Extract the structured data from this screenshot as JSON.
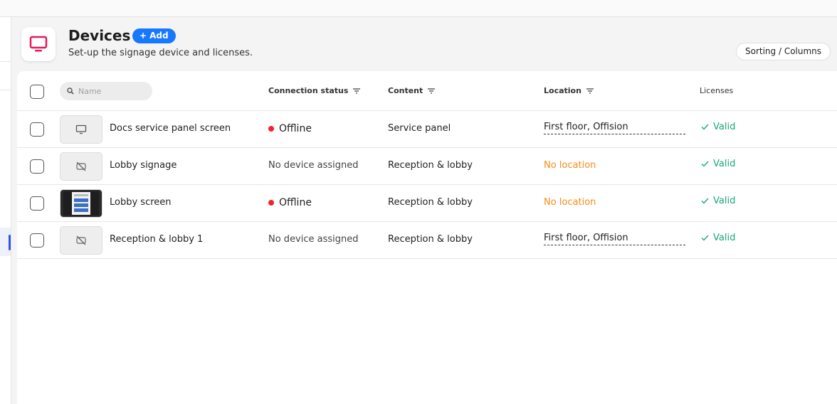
{
  "page": {
    "title": "Devices",
    "add_label": "Add",
    "subtitle": "Set-up the signage device and licenses.",
    "sorting_label": "Sorting / Columns"
  },
  "table": {
    "search_placeholder": "Name",
    "columns": {
      "connection_status": "Connection status",
      "content": "Content",
      "location": "Location",
      "licenses": "Licenses"
    },
    "rows": [
      {
        "name": "Docs service panel screen",
        "status": "Offline",
        "content": "Service panel",
        "location": "First floor, Offision",
        "license": "Valid"
      },
      {
        "name": "Lobby signage",
        "status": "No device assigned",
        "content": "Reception & lobby",
        "location": "No location",
        "license": "Valid"
      },
      {
        "name": "Lobby screen",
        "status": "Offline",
        "content": "Reception & lobby",
        "location": "No location",
        "license": "Valid"
      },
      {
        "name": "Reception & lobby 1",
        "status": "No device assigned",
        "content": "Reception & lobby",
        "location": "First floor, Offision",
        "license": "Valid"
      }
    ]
  },
  "colors": {
    "accent": "#1677ff",
    "brand_icon": "#e8195a",
    "offline": "#f5222d",
    "valid": "#17a878",
    "no_location": "#fa8c16"
  },
  "icons": {
    "header": "monitor-icon",
    "search": "search-icon",
    "filter": "filter-icon",
    "add": "plus-icon",
    "valid": "check-icon",
    "thumbnails": [
      "monitor-icon",
      "unlinked-icon",
      "screen-preview-image",
      "unlinked-icon"
    ]
  }
}
